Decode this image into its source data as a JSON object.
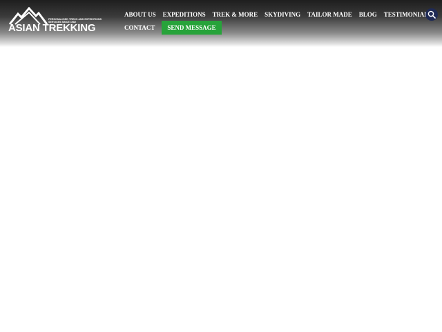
{
  "header": {
    "logo": {
      "wordmark": "ASIAN TREKKING",
      "tagline": "PERSONALISED TREKS AND EXPEDITIONS SERVICES SINCE 1982"
    },
    "nav": {
      "items": [
        "ABOUT US",
        "EXPEDITIONS",
        "TREK & MORE",
        "SKYDIVING",
        "TAILOR MADE",
        "BLOG",
        "TESTIMONIALS"
      ],
      "contact": "CONTACT",
      "send_message": "SEND MESSAGE"
    },
    "search": {
      "icon": "search-icon"
    }
  },
  "colors": {
    "header_dark": "#1e1e1e",
    "cta_green": "#27a33a",
    "search_bg": "#1f2a55",
    "text_light": "#ffffff"
  }
}
